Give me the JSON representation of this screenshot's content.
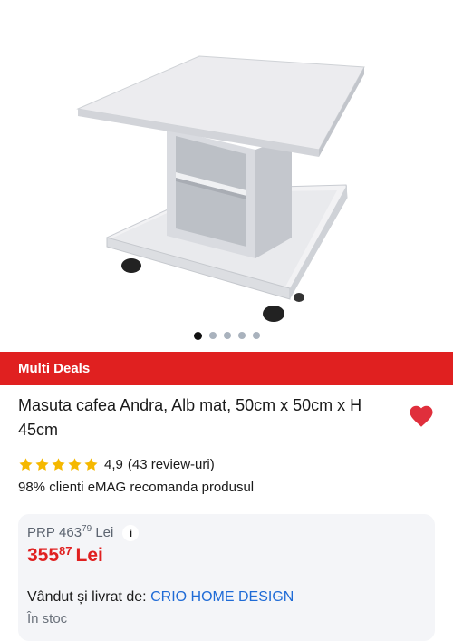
{
  "gallery": {
    "image_alt": "Masuta cafea Andra, Alb mat",
    "slide_count": 5,
    "active_slide": 1
  },
  "deals_bar": {
    "label": "Multi Deals"
  },
  "product": {
    "title": "Masuta cafea Andra, Alb mat, 50cm x 50cm x H 45cm",
    "favorite_icon": "heart-icon",
    "favorite_color": "#e02f3c"
  },
  "rating": {
    "stars": 5,
    "star_color": "#f5b800",
    "value": "4,9",
    "reviews": "(43 review-uri)"
  },
  "recommend_text": "98% clienti eMAG recomanda produsul",
  "pricing": {
    "prp_label": "PRP",
    "prp_int": "463",
    "prp_dec": "79",
    "prp_currency": "Lei",
    "info_label": "i",
    "price_int": "355",
    "price_dec": "87",
    "price_currency": "Lei",
    "price_color": "#e02020"
  },
  "seller": {
    "label": "Vândut și livrat de:",
    "name": "CRIO HOME DESIGN",
    "link_color": "#1f6bd6"
  },
  "stock": {
    "label": "În stoc"
  }
}
